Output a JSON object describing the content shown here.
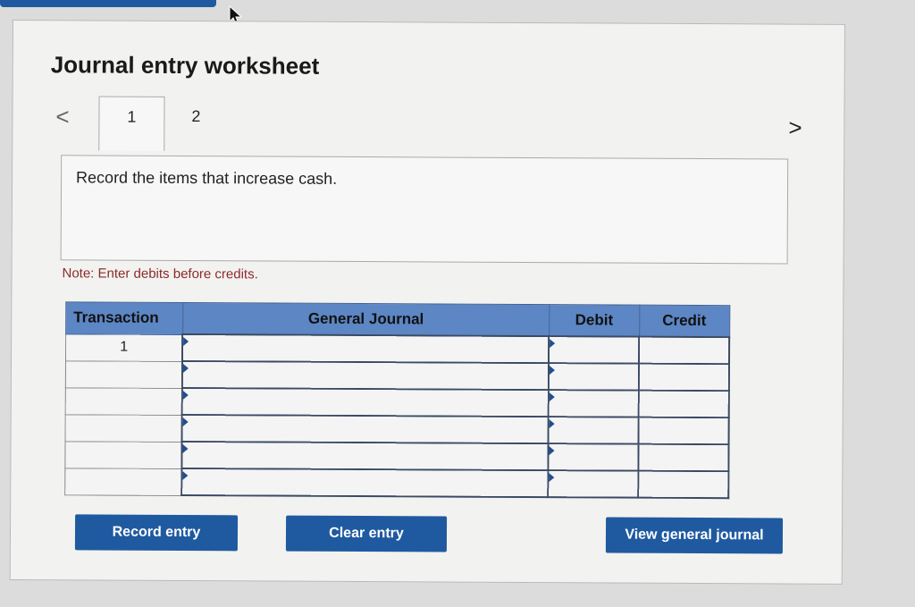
{
  "worksheet": {
    "title": "Journal entry worksheet",
    "nav": {
      "prev": "<",
      "next": ">"
    },
    "tabs": [
      {
        "label": "1",
        "active": true
      },
      {
        "label": "2",
        "active": false
      }
    ],
    "instruction": "Record the items that increase cash.",
    "note": "Note: Enter debits before credits."
  },
  "table": {
    "headers": [
      "Transaction",
      "General Journal",
      "Debit",
      "Credit"
    ],
    "rows": [
      {
        "transaction": "1",
        "journal": "",
        "debit": "",
        "credit": ""
      },
      {
        "transaction": "",
        "journal": "",
        "debit": "",
        "credit": ""
      },
      {
        "transaction": "",
        "journal": "",
        "debit": "",
        "credit": ""
      },
      {
        "transaction": "",
        "journal": "",
        "debit": "",
        "credit": ""
      },
      {
        "transaction": "",
        "journal": "",
        "debit": "",
        "credit": ""
      },
      {
        "transaction": "",
        "journal": "",
        "debit": "",
        "credit": ""
      }
    ]
  },
  "buttons": {
    "record": "Record entry",
    "clear": "Clear entry",
    "view": "View general journal"
  },
  "colors": {
    "accent": "#1f5aa0",
    "header_bg": "#5c86c4",
    "note": "#8b2a2a"
  },
  "icons": {
    "cursor": "mouse-pointer-icon",
    "prev": "chevron-left-icon",
    "next": "chevron-right-icon",
    "row_marker": "triangle-right-icon"
  }
}
